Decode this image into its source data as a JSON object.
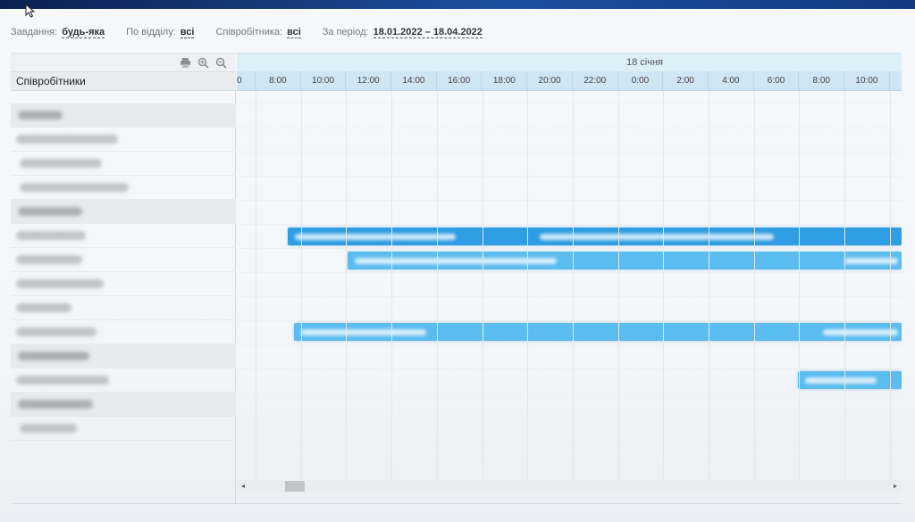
{
  "filters": {
    "task_label": "Завдання:",
    "task_value": "будь-яка",
    "dept_label": "По відділу:",
    "dept_value": "всі",
    "employee_label": "Співробітника:",
    "employee_value": "всі",
    "period_label": "За період:",
    "period_value": "18.01.2022 – 18.04.2022"
  },
  "left_panel": {
    "header": "Співробітники",
    "toolbar_icons": [
      "print-icon",
      "zoom-in-icon",
      "zoom-out-icon"
    ],
    "rows": [
      {
        "type": "group"
      },
      {
        "type": "employee"
      },
      {
        "type": "employee"
      },
      {
        "type": "employee"
      },
      {
        "type": "group"
      },
      {
        "type": "employee"
      },
      {
        "type": "employee"
      },
      {
        "type": "employee"
      },
      {
        "type": "employee"
      },
      {
        "type": "employee"
      },
      {
        "type": "group"
      },
      {
        "type": "employee"
      },
      {
        "type": "group"
      },
      {
        "type": "employee"
      }
    ]
  },
  "timeline": {
    "date": "18 січня",
    "ticks": [
      "0",
      "8:00",
      "10:00",
      "12:00",
      "14:00",
      "16:00",
      "18:00",
      "20:00",
      "22:00",
      "0:00",
      "2:00",
      "4:00",
      "6:00",
      "8:00",
      "10:00"
    ]
  },
  "colors": {
    "bar_primary": "#2f9de3",
    "bar_light": "#5bbcf0",
    "header_bg": "#cfe6f4",
    "topbar": "#1e4f9f"
  },
  "scrollbar": {
    "left_arrow": "◂",
    "right_arrow": "▸"
  }
}
